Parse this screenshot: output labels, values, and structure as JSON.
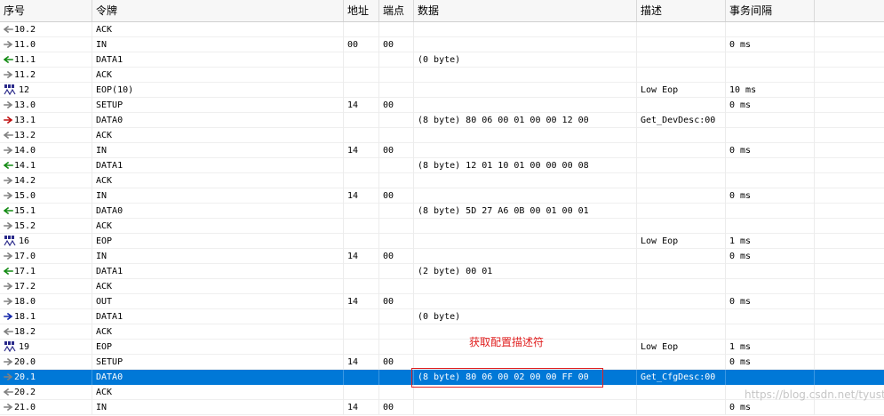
{
  "columns": [
    "序号",
    "令牌",
    "地址",
    "端点",
    "数据",
    "描述",
    "事务间隔",
    ""
  ],
  "colors": {
    "arrow_in": "#128a12",
    "arrow_out_red": "#c01010",
    "arrow_out_blue": "#1024a8",
    "arrow_grey": "#808080",
    "selection": "#0078d7",
    "annotation": "#e02020"
  },
  "rows": [
    {
      "icon": "arrow-left-gray-icon",
      "id": "10.2",
      "token": "ACK",
      "addr": "",
      "ep": "",
      "data": "",
      "desc": "",
      "interval": ""
    },
    {
      "icon": "arrow-right-gray-icon",
      "id": "11.0",
      "token": "IN",
      "addr": "00",
      "ep": "00",
      "data": "",
      "desc": "",
      "interval": "0 ms"
    },
    {
      "icon": "arrow-left-green-icon",
      "id": "11.1",
      "token": "DATA1",
      "addr": "",
      "ep": "",
      "data": "(0 byte)",
      "desc": "",
      "interval": ""
    },
    {
      "icon": "arrow-right-gray-icon",
      "id": "11.2",
      "token": "ACK",
      "addr": "",
      "ep": "",
      "data": "",
      "desc": "",
      "interval": ""
    },
    {
      "icon": "seo-icon",
      "id": "12",
      "token": "EOP(10)",
      "addr": "",
      "ep": "",
      "data": "",
      "desc": "Low Eop",
      "interval": "10 ms"
    },
    {
      "icon": "arrow-right-gray-icon",
      "id": "13.0",
      "token": "SETUP",
      "addr": "14",
      "ep": "00",
      "data": "",
      "desc": "",
      "interval": "0 ms"
    },
    {
      "icon": "arrow-right-red-icon",
      "id": "13.1",
      "token": "DATA0",
      "addr": "",
      "ep": "",
      "data": "(8 byte) 80 06 00 01 00 00 12 00",
      "desc": "Get_DevDesc:00",
      "interval": ""
    },
    {
      "icon": "arrow-left-gray-icon",
      "id": "13.2",
      "token": "ACK",
      "addr": "",
      "ep": "",
      "data": "",
      "desc": "",
      "interval": ""
    },
    {
      "icon": "arrow-right-gray-icon",
      "id": "14.0",
      "token": "IN",
      "addr": "14",
      "ep": "00",
      "data": "",
      "desc": "",
      "interval": "0 ms"
    },
    {
      "icon": "arrow-left-green-icon",
      "id": "14.1",
      "token": "DATA1",
      "addr": "",
      "ep": "",
      "data": "(8 byte) 12 01 10 01 00 00 00 08",
      "desc": "",
      "interval": ""
    },
    {
      "icon": "arrow-right-gray-icon",
      "id": "14.2",
      "token": "ACK",
      "addr": "",
      "ep": "",
      "data": "",
      "desc": "",
      "interval": ""
    },
    {
      "icon": "arrow-right-gray-icon",
      "id": "15.0",
      "token": "IN",
      "addr": "14",
      "ep": "00",
      "data": "",
      "desc": "",
      "interval": "0 ms"
    },
    {
      "icon": "arrow-left-green-icon",
      "id": "15.1",
      "token": "DATA0",
      "addr": "",
      "ep": "",
      "data": "(8 byte) 5D 27 A6 0B 00 01 00 01",
      "desc": "",
      "interval": ""
    },
    {
      "icon": "arrow-right-gray-icon",
      "id": "15.2",
      "token": "ACK",
      "addr": "",
      "ep": "",
      "data": "",
      "desc": "",
      "interval": ""
    },
    {
      "icon": "seo-icon",
      "id": "16",
      "token": "EOP",
      "addr": "",
      "ep": "",
      "data": "",
      "desc": "Low Eop",
      "interval": "1 ms"
    },
    {
      "icon": "arrow-right-gray-icon",
      "id": "17.0",
      "token": "IN",
      "addr": "14",
      "ep": "00",
      "data": "",
      "desc": "",
      "interval": "0 ms"
    },
    {
      "icon": "arrow-left-green-icon",
      "id": "17.1",
      "token": "DATA1",
      "addr": "",
      "ep": "",
      "data": "(2 byte) 00 01",
      "desc": "",
      "interval": ""
    },
    {
      "icon": "arrow-right-gray-icon",
      "id": "17.2",
      "token": "ACK",
      "addr": "",
      "ep": "",
      "data": "",
      "desc": "",
      "interval": ""
    },
    {
      "icon": "arrow-right-gray-icon",
      "id": "18.0",
      "token": "OUT",
      "addr": "14",
      "ep": "00",
      "data": "",
      "desc": "",
      "interval": "0 ms"
    },
    {
      "icon": "arrow-right-blue-icon",
      "id": "18.1",
      "token": "DATA1",
      "addr": "",
      "ep": "",
      "data": "(0 byte)",
      "desc": "",
      "interval": ""
    },
    {
      "icon": "arrow-left-gray-icon",
      "id": "18.2",
      "token": "ACK",
      "addr": "",
      "ep": "",
      "data": "",
      "desc": "",
      "interval": ""
    },
    {
      "icon": "seo-icon",
      "id": "19",
      "token": "EOP",
      "addr": "",
      "ep": "",
      "data": "",
      "desc": "Low Eop",
      "interval": "1 ms"
    },
    {
      "icon": "arrow-right-gray-icon",
      "id": "20.0",
      "token": "SETUP",
      "addr": "14",
      "ep": "00",
      "data": "",
      "desc": "",
      "interval": "0 ms"
    },
    {
      "icon": "arrow-right-gray-icon",
      "id": "20.1",
      "token": "DATA0",
      "addr": "",
      "ep": "",
      "data": "(8 byte) 80 06 00 02 00 00 FF 00",
      "desc": "Get_CfgDesc:00",
      "interval": "",
      "selected": true
    },
    {
      "icon": "arrow-left-gray-icon",
      "id": "20.2",
      "token": "ACK",
      "addr": "",
      "ep": "",
      "data": "",
      "desc": "",
      "interval": ""
    },
    {
      "icon": "arrow-right-gray-icon",
      "id": "21.0",
      "token": "IN",
      "addr": "14",
      "ep": "00",
      "data": "",
      "desc": "",
      "interval": "0 ms"
    }
  ],
  "annotation": "获取配置描述符",
  "watermark": "https://blog.csdn.net/tyustli"
}
